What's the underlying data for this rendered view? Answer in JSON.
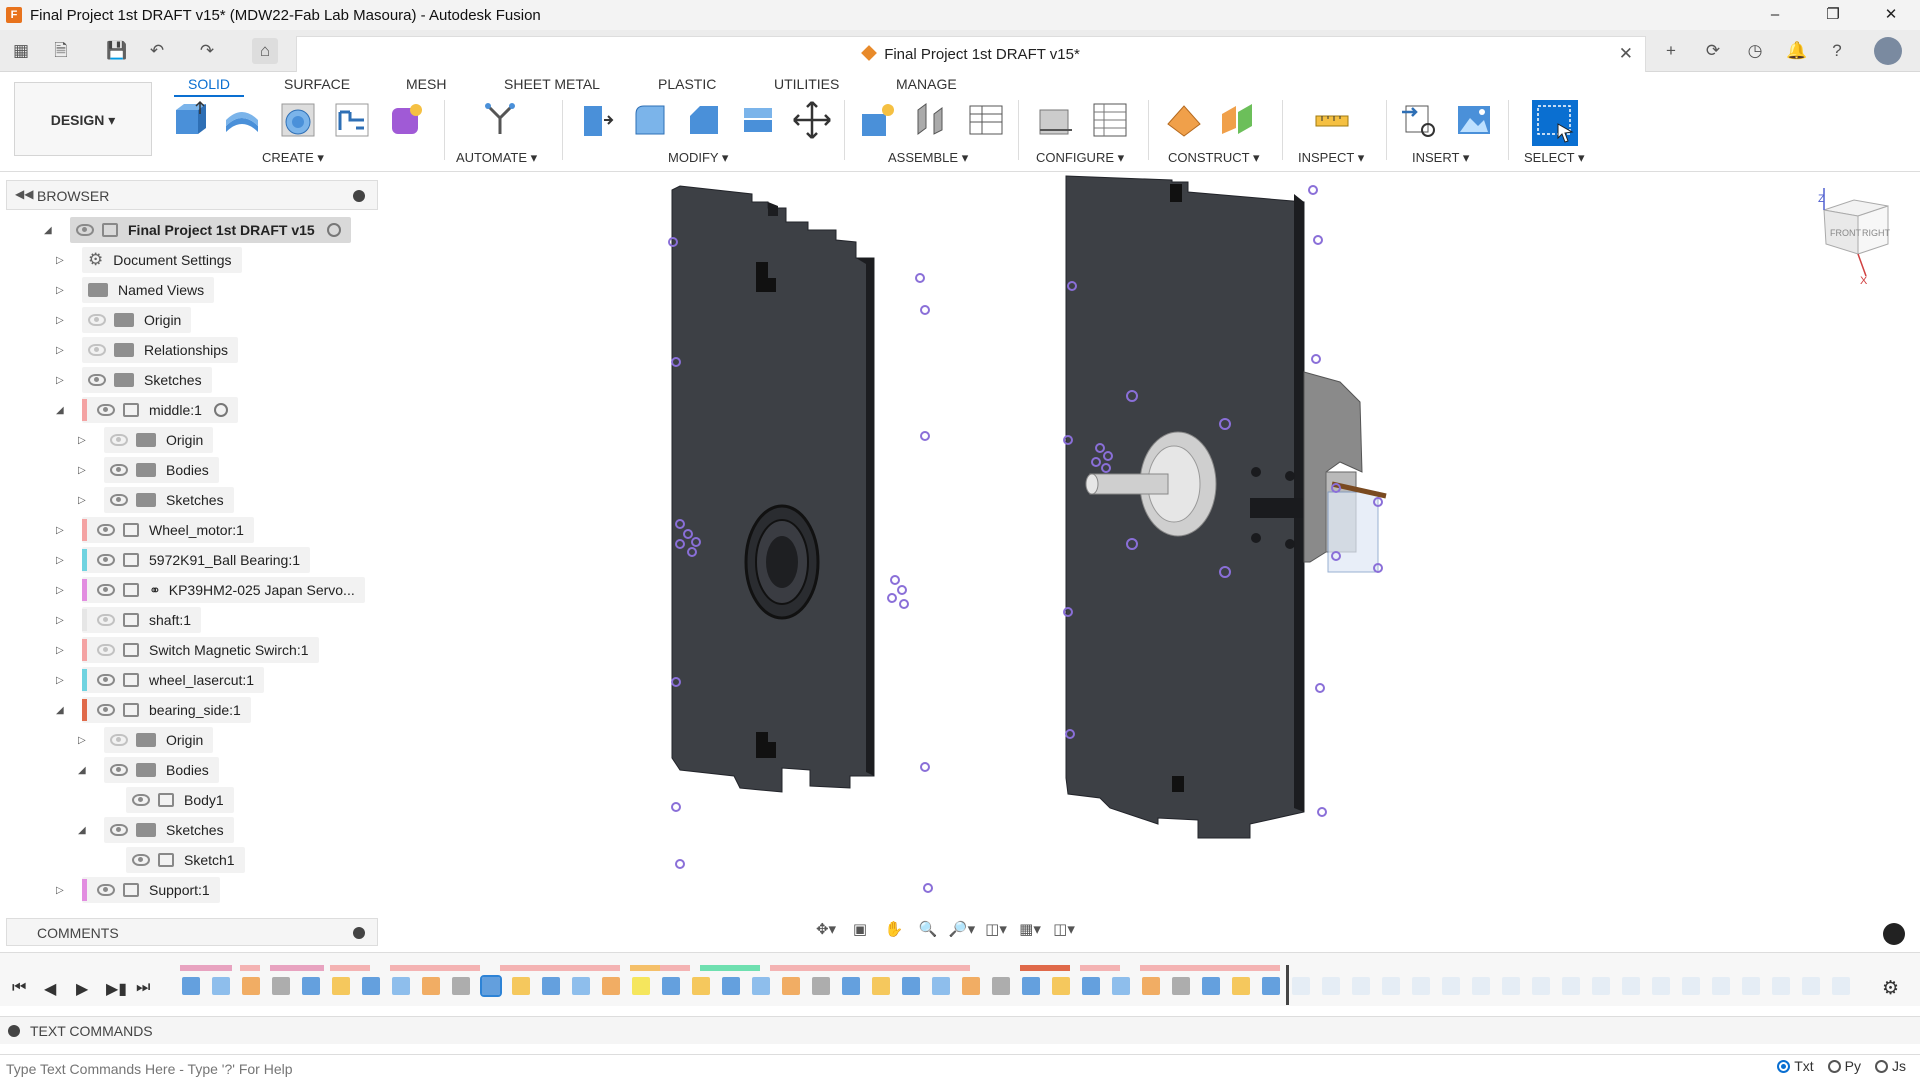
{
  "window": {
    "title": "Final Project 1st DRAFT v15* (MDW22-Fab Lab Masoura) - Autodesk Fusion",
    "app_icon": "fusion-icon",
    "controls": [
      "–",
      "❐",
      "✕"
    ]
  },
  "document_tab": {
    "label": "Final Project 1st DRAFT v15*"
  },
  "workspace": {
    "label": "DESIGN ▾"
  },
  "ribbon": {
    "tabs": [
      "SOLID",
      "SURFACE",
      "MESH",
      "SHEET METAL",
      "PLASTIC",
      "UTILITIES",
      "MANAGE"
    ],
    "active_tab": "SOLID",
    "groups": [
      "CREATE ▾",
      "AUTOMATE ▾",
      "MODIFY ▾",
      "ASSEMBLE ▾",
      "CONFIGURE ▾",
      "CONSTRUCT ▾",
      "INSPECT ▾",
      "INSERT ▾",
      "SELECT ▾"
    ]
  },
  "browser": {
    "title": "BROWSER",
    "items": [
      {
        "label": "Final Project 1st DRAFT v15",
        "level": 0
      },
      {
        "label": "Document Settings",
        "level": 1
      },
      {
        "label": "Named Views",
        "level": 1
      },
      {
        "label": "Origin",
        "level": 1
      },
      {
        "label": "Relationships",
        "level": 1
      },
      {
        "label": "Sketches",
        "level": 1
      },
      {
        "label": "middle:1",
        "level": 1
      },
      {
        "label": "Origin",
        "level": 2
      },
      {
        "label": "Bodies",
        "level": 2
      },
      {
        "label": "Sketches",
        "level": 2
      },
      {
        "label": "Wheel_motor:1",
        "level": 1
      },
      {
        "label": "5972K91_Ball Bearing:1",
        "level": 1
      },
      {
        "label": "KP39HM2-025 Japan Servo...",
        "level": 1
      },
      {
        "label": "shaft:1",
        "level": 1
      },
      {
        "label": "Switch Magnetic Swirch:1",
        "level": 1
      },
      {
        "label": "wheel_lasercut:1",
        "level": 1
      },
      {
        "label": "bearing_side:1",
        "level": 1
      },
      {
        "label": "Origin",
        "level": 2
      },
      {
        "label": "Bodies",
        "level": 2
      },
      {
        "label": "Body1",
        "level": 3
      },
      {
        "label": "Sketches",
        "level": 2
      },
      {
        "label": "Sketch1",
        "level": 3
      },
      {
        "label": "Support:1",
        "level": 1
      }
    ]
  },
  "comments": {
    "title": "COMMENTS"
  },
  "viewcube": {
    "front": "FRONT",
    "right": "RIGHT",
    "z": "Z",
    "x": "X"
  },
  "text_commands": {
    "title": "TEXT COMMANDS",
    "placeholder": "Type Text Commands Here - Type '?' For Help",
    "modes": [
      "Txt",
      "Py",
      "Js"
    ],
    "selected_mode": "Txt"
  },
  "colors": {
    "accent": "#0a6fd1",
    "plate": "#3d4045",
    "plate_edge": "#1c1d20",
    "selection": "#8a6fd8"
  }
}
